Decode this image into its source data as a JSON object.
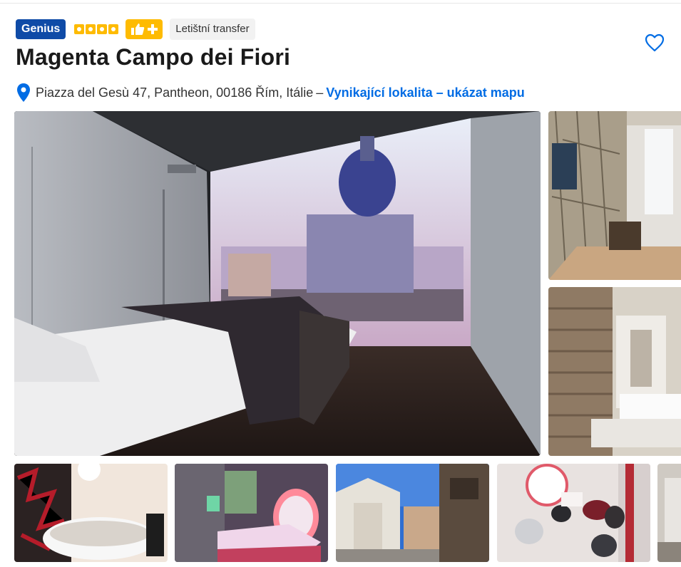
{
  "header": {
    "genius_label": "Genius",
    "star_rating": 4,
    "preferred_icon": "thumbs-up-plus-icon",
    "chip_label": "Letištní transfer",
    "title": "Magenta Campo dei Fiori",
    "favorite_icon": "heart-icon"
  },
  "address": {
    "icon": "map-pin-icon",
    "text": "Piazza del Gesù 47, Pantheon, 00186 Řím, Itálie",
    "separator": "–",
    "map_link": "Vynikající lokalita – ukázat mapu"
  },
  "colors": {
    "genius_blue": "#0f4ba7",
    "star_yellow": "#febb02",
    "link_blue": "#006ce4",
    "heart_blue": "#006ce4"
  }
}
